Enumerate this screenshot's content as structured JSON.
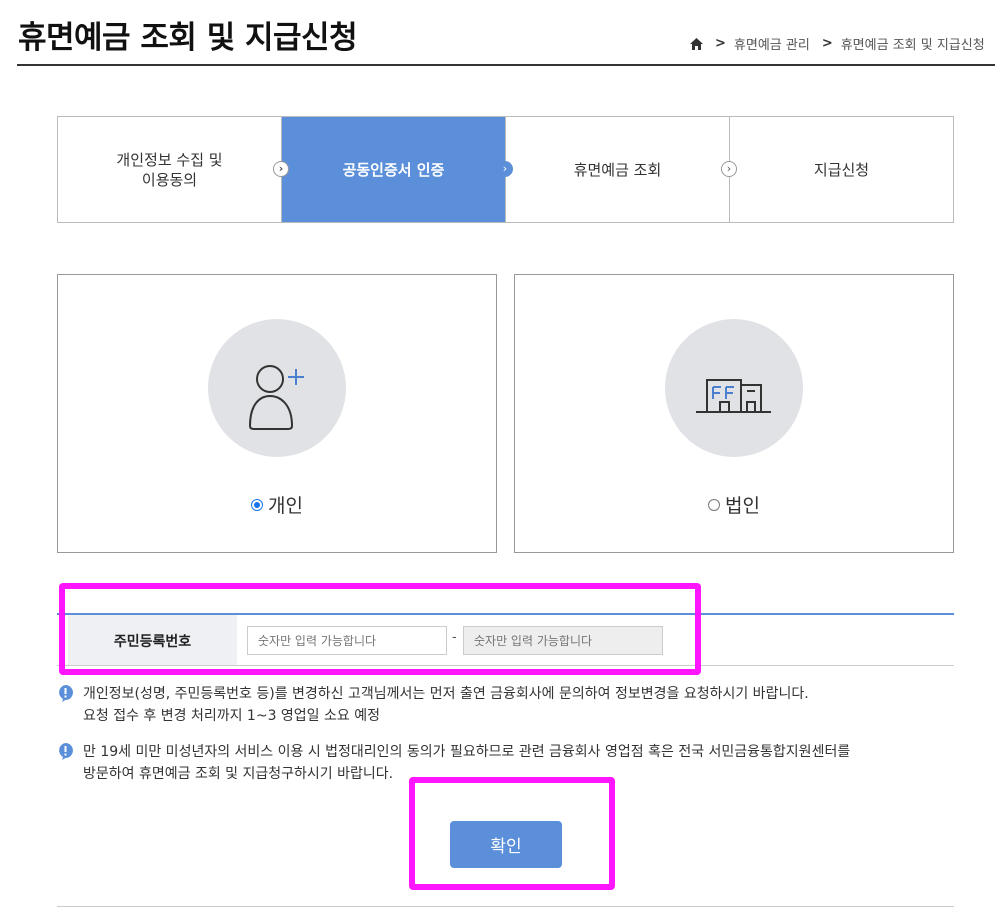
{
  "header": {
    "title": "휴면예금 조회 및 지급신청",
    "breadcrumb": [
      "휴면예금 관리",
      "휴면예금 조회 및 지급신청"
    ]
  },
  "steps": [
    {
      "label": "개인정보 수집 및\n이용동의",
      "active": false
    },
    {
      "label": "공동인증서 인증",
      "active": true
    },
    {
      "label": "휴면예금 조회",
      "active": false
    },
    {
      "label": "지급신청",
      "active": false
    }
  ],
  "cards": {
    "individual": {
      "label": "개인",
      "icon": "person-add-icon",
      "selected": true
    },
    "corporate": {
      "label": "법인",
      "icon": "building-icon",
      "selected": false
    }
  },
  "form": {
    "label": "주민등록번호",
    "first_placeholder": "숫자만 입력 가능합니다",
    "separator": "-",
    "second_placeholder": "숫자만 입력 가능합니다"
  },
  "notices": [
    "개인정보(성명, 주민등록번호 등)를 변경하신 고객님께서는 먼저 출연 금융회사에 문의하여 정보변경을 요청하시기 바랍니다.\n요청 접수 후 변경 처리까지 1~3 영업일 소요 예정",
    "만 19세 미만 미성년자의 서비스 이용 시 법정대리인의 동의가 필요하므로 관련 금융회사 영업점 혹은 전국 서민금융통합지원센터를\n방문하여 휴면예금 조회 및 지급청구하시기 바랍니다."
  ],
  "confirm_label": "확인",
  "colors": {
    "accent": "#5b8fd9",
    "highlight": "#ff16ff"
  }
}
